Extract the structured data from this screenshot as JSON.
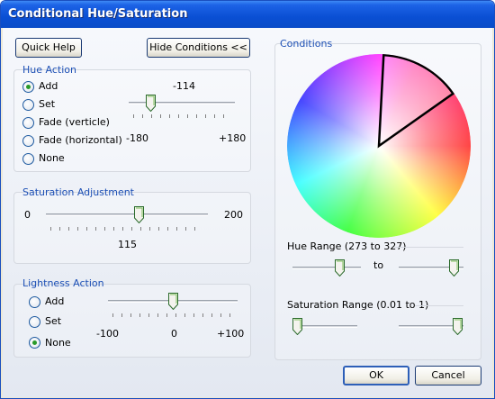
{
  "window": {
    "title": "Conditional Hue/Saturation"
  },
  "buttons": {
    "quick_help": "Quick Help",
    "hide_conditions": "Hide Conditions <<",
    "ok": "OK",
    "cancel": "Cancel"
  },
  "hue_action": {
    "title": "Hue Action",
    "options": [
      "Add",
      "Set",
      "Fade (verticle)",
      "Fade (horizontal)",
      "None"
    ],
    "selected": "Add",
    "value": "-114",
    "min_label": "-180",
    "max_label": "+180",
    "slider_value": -114
  },
  "saturation": {
    "title": "Saturation Adjustment",
    "min_label": "0",
    "max_label": "200",
    "value": "115",
    "slider_value": 115
  },
  "lightness": {
    "title": "Lightness Action",
    "options": [
      "Add",
      "Set",
      "None"
    ],
    "selected": "None",
    "min_label": "-100",
    "mid_label": "0",
    "max_label": "+100"
  },
  "conditions": {
    "title": "Conditions",
    "hue_range": {
      "title": "Hue Range (273 to 327)",
      "to_label": "to",
      "from": 273,
      "to": 327
    },
    "saturation_range": {
      "title": "Saturation Range (0.01 to 1)",
      "from": 0.01,
      "to": 1
    }
  },
  "colors": {
    "accent_title": "#1c4fb5",
    "radio_dot": "#2a9a2a",
    "titlebar": "#0a4fd4"
  }
}
